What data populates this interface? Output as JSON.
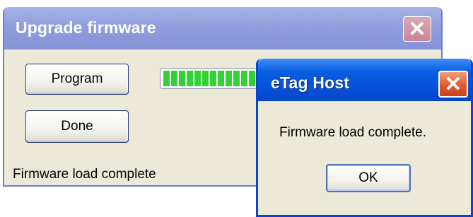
{
  "upgrade_window": {
    "title": "Upgrade firmware",
    "program_label": "Program",
    "done_label": "Done",
    "status": "Firmware load complete",
    "progress_fraction": 1.0,
    "progress_color": "#2fd12f"
  },
  "dialog": {
    "title": "eTag Host",
    "message": "Firmware load complete.",
    "ok_label": "OK"
  },
  "icons": {
    "close": "close-icon"
  },
  "colors": {
    "dialog_titlebar": "#0650d8",
    "inactive_titlebar": "#8f9ddd",
    "window_face": "#ece9d8",
    "close_active": "#e05b2b",
    "close_inactive": "#c98496"
  }
}
